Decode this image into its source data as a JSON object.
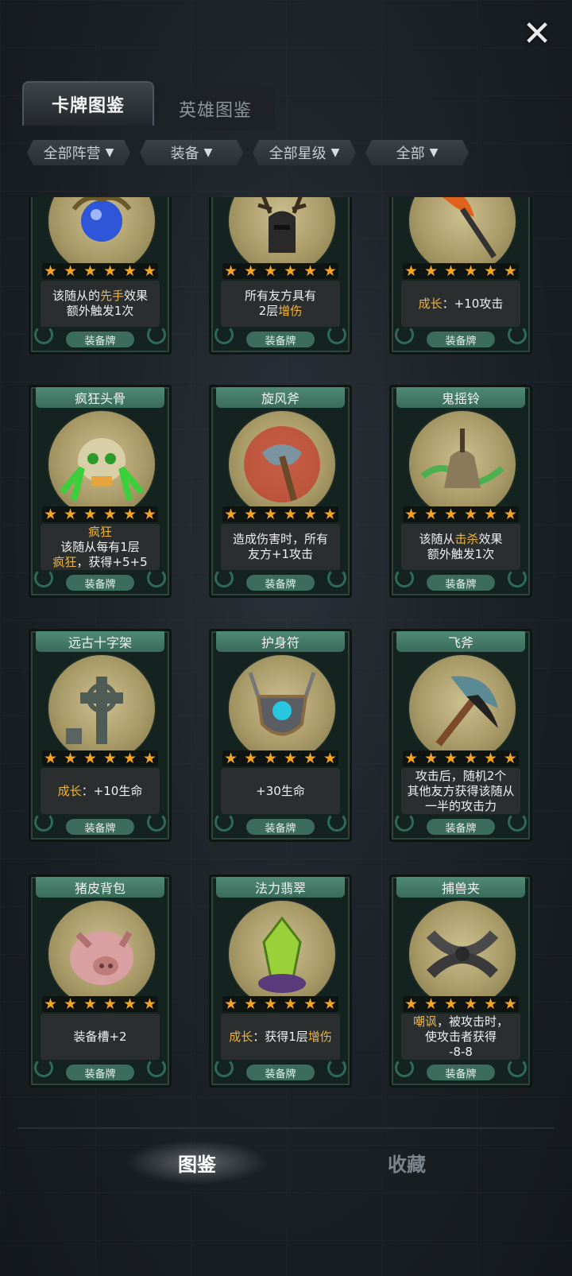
{
  "close": {
    "icon": "close-x-icon",
    "glyph": "✕"
  },
  "tabs": [
    {
      "label": "卡牌图鉴",
      "active": true
    },
    {
      "label": "英雄图鉴",
      "active": false
    }
  ],
  "filters": [
    {
      "label": "全部阵营"
    },
    {
      "label": "装备"
    },
    {
      "label": "全部星级"
    },
    {
      "label": "全部"
    }
  ],
  "filter_icon": "funnel-icon",
  "star_glyph": "★",
  "cards": [
    {
      "name": "",
      "icon": "blue-orb-icon",
      "stars": 6,
      "desc": [
        [
          "该随从的",
          [
            "先手"
          ],
          "效果"
        ],
        [
          "额外触发1次"
        ]
      ],
      "type": "装备牌"
    },
    {
      "name": "",
      "icon": "antler-helmet-icon",
      "stars": 6,
      "desc": [
        [
          "所有友方具有"
        ],
        [
          "2层",
          [
            "增伤"
          ]
        ]
      ],
      "type": "装备牌"
    },
    {
      "name": "",
      "icon": "flame-axe-icon",
      "stars": 6,
      "desc": [
        [
          [
            "成长"
          ],
          "：+10攻击"
        ]
      ],
      "type": "装备牌"
    },
    {
      "name": "疯狂头骨",
      "icon": "green-skull-icon",
      "stars": 6,
      "desc": [
        [
          [
            "疯狂"
          ]
        ],
        [
          "该随从每有1层"
        ],
        [
          [
            "疯狂"
          ],
          "，获得+5+5"
        ]
      ],
      "type": "装备牌"
    },
    {
      "name": "旋风斧",
      "icon": "whirlwind-axe-icon",
      "stars": 6,
      "desc": [
        [
          "造成伤害时，所有"
        ],
        [
          "友方+1攻击"
        ]
      ],
      "type": "装备牌"
    },
    {
      "name": "鬼摇铃",
      "icon": "ghost-bell-icon",
      "stars": 6,
      "desc": [
        [
          "该随从",
          [
            "击杀"
          ],
          "效果"
        ],
        [
          "额外触发1次"
        ]
      ],
      "type": "装备牌"
    },
    {
      "name": "远古十字架",
      "icon": "celtic-cross-icon",
      "stars": 6,
      "desc": [
        [
          [
            "成长"
          ],
          "：+10生命"
        ]
      ],
      "type": "装备牌"
    },
    {
      "name": "护身符",
      "icon": "amulet-shield-icon",
      "stars": 6,
      "desc": [
        [
          "+30生命"
        ]
      ],
      "type": "装备牌"
    },
    {
      "name": "飞斧",
      "icon": "throwing-axe-icon",
      "stars": 6,
      "desc": [
        [
          "攻击后，随机2个"
        ],
        [
          "其他友方获得该随从"
        ],
        [
          "一半的攻击力"
        ]
      ],
      "type": "装备牌"
    },
    {
      "name": "猪皮背包",
      "icon": "pig-backpack-icon",
      "stars": 6,
      "desc": [
        [
          "装备槽+2"
        ]
      ],
      "type": "装备牌"
    },
    {
      "name": "法力翡翠",
      "icon": "mana-crystal-icon",
      "stars": 6,
      "desc": [
        [
          [
            "成长"
          ],
          "：获得1层",
          [
            "增伤"
          ]
        ]
      ],
      "type": "装备牌"
    },
    {
      "name": "捕兽夹",
      "icon": "bear-trap-icon",
      "stars": 6,
      "desc": [
        [
          [
            "嘲讽"
          ],
          "，被攻击时，"
        ],
        [
          "使攻击者获得"
        ],
        [
          "-8-8"
        ]
      ],
      "type": "装备牌"
    }
  ],
  "bottom_nav": [
    {
      "label": "图鉴",
      "active": true
    },
    {
      "label": "收藏",
      "active": false
    }
  ],
  "colors": {
    "highlight": "#f0b43a",
    "star": "#f3a522",
    "card_green": "#4f8b76"
  }
}
